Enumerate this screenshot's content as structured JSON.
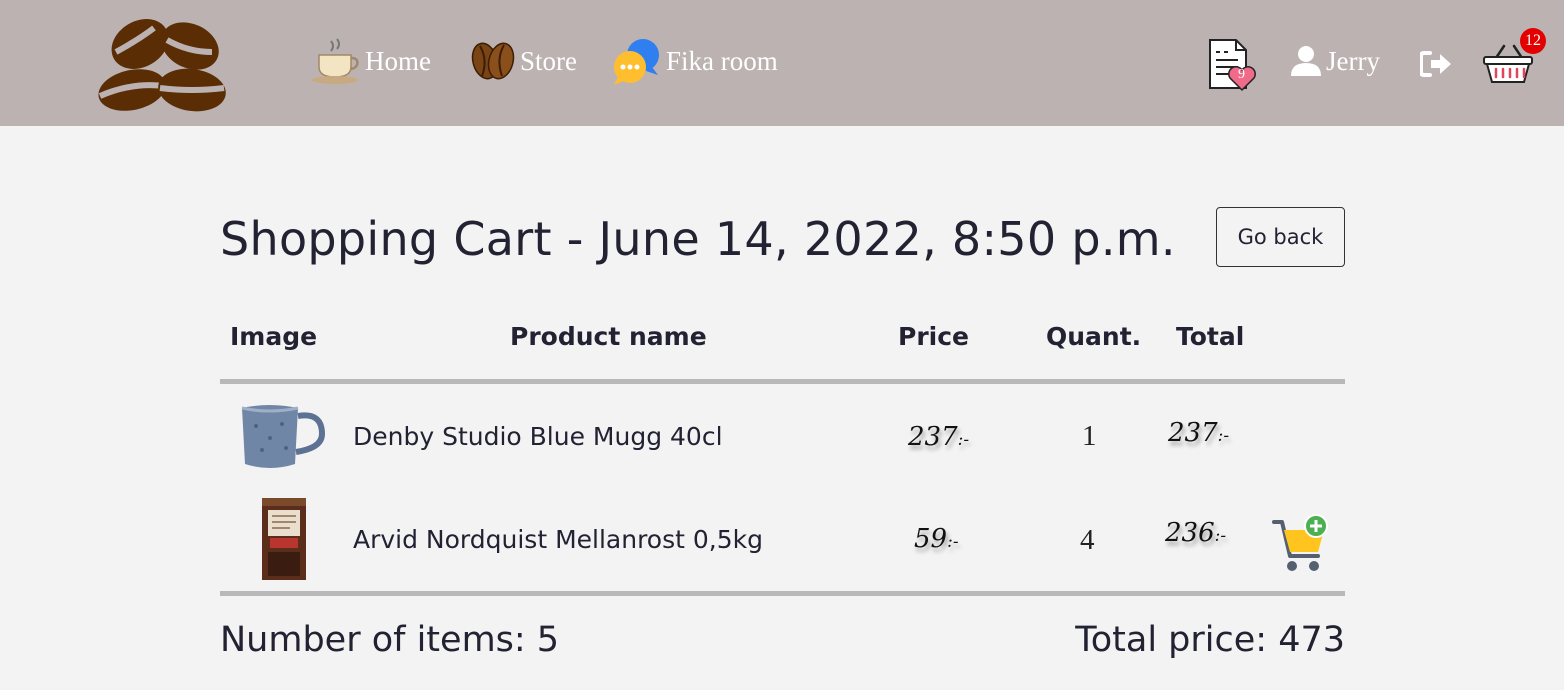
{
  "nav": {
    "items": [
      {
        "label": "Home",
        "icon": "coffee-cup-icon"
      },
      {
        "label": "Store",
        "icon": "coffee-bean-icon"
      },
      {
        "label": "Fika room",
        "icon": "chat-bubbles-icon"
      }
    ],
    "favorites_count": "9",
    "user_name": "Jerry",
    "cart_count": "12"
  },
  "page": {
    "title": "Shopping Cart - June 14, 2022, 8:50 p.m.",
    "go_back_label": "Go back"
  },
  "table": {
    "headers": [
      "Image",
      "Product name",
      "Price",
      "Quant.",
      "Total"
    ],
    "rows": [
      {
        "name": "Denby Studio Blue Mugg 40cl",
        "price": "237",
        "quantity": "1",
        "total": "237",
        "image": "blue-mug"
      },
      {
        "name": "Arvid Nordquist Mellanrost 0,5kg",
        "price": "59",
        "quantity": "4",
        "total": "236",
        "image": "coffee-package"
      }
    ],
    "price_suffix": ":-"
  },
  "summary": {
    "items_text": "Number of items: 5",
    "total_text": "Total price: 473"
  },
  "colors": {
    "navbar": "#bcb2b2",
    "background": "#f3f3f3",
    "bean": "#5a2d05",
    "badge": "#e30000",
    "rule": "#b8b8b8"
  }
}
